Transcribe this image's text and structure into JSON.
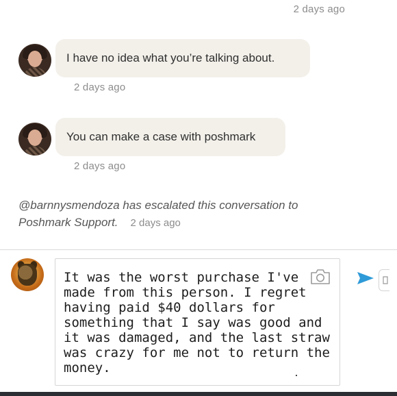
{
  "thread": {
    "top_timestamp": "2 days ago",
    "messages": [
      {
        "text": "I have no idea what you’re talking about.",
        "timestamp": "2 days ago"
      },
      {
        "text": "You can make a case with poshmark",
        "timestamp": "2 days ago"
      }
    ],
    "system_notice": {
      "text": "@barnnysmendoza has escalated this conversation to Poshmark Support.",
      "timestamp": "2 days ago"
    }
  },
  "composer": {
    "draft": "It was the worst purchase I've made from this person. I regret having paid $40 dollars for something that I say was good and it was damaged, and the last straw was crazy for me not to return the money."
  },
  "icons": {
    "camera": "camera-icon",
    "send": "send-icon",
    "attach": "attachment-icon"
  },
  "colors": {
    "send_blue": "#2e9ad8",
    "bubble_bg": "#f3f0ea",
    "timestamp_gray": "#8c8c8c"
  }
}
